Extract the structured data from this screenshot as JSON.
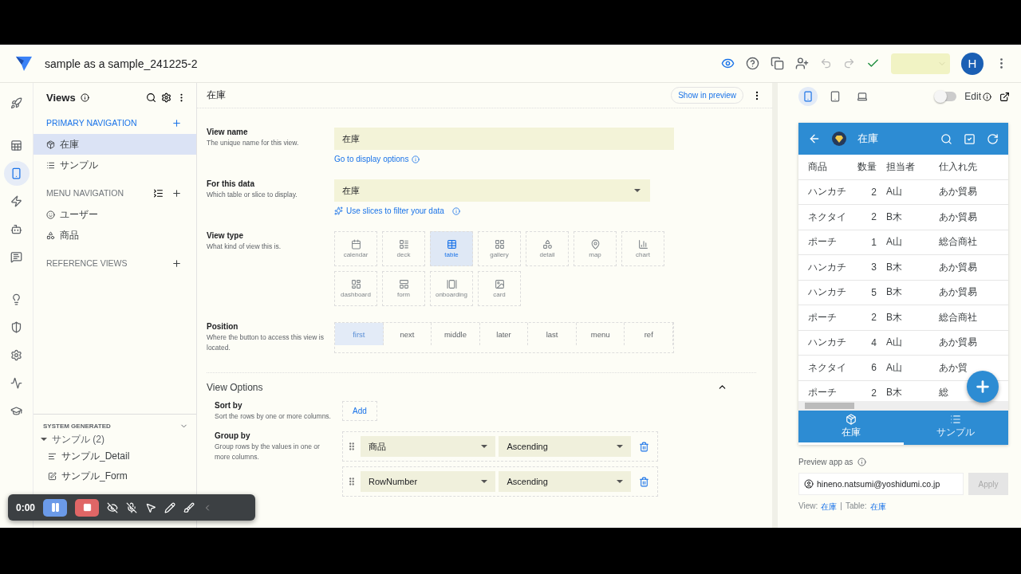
{
  "app": {
    "title": "sample as a sample_241225-2",
    "avatar": "H"
  },
  "rail": [
    {
      "items": [
        {
          "kind": "rocket",
          "selected": false
        }
      ]
    },
    {
      "items": [
        {
          "kind": "table",
          "selected": false
        },
        {
          "kind": "phone",
          "selected": true
        },
        {
          "kind": "bolt",
          "selected": false
        },
        {
          "kind": "bot",
          "selected": false
        },
        {
          "kind": "chat",
          "selected": false
        }
      ]
    },
    {
      "items": [
        {
          "kind": "bulb",
          "selected": false
        },
        {
          "kind": "shield",
          "selected": false
        },
        {
          "kind": "gear",
          "selected": false
        },
        {
          "kind": "monitor",
          "selected": false
        },
        {
          "kind": "school",
          "selected": false
        }
      ]
    }
  ],
  "views_panel": {
    "title": "Views",
    "sections": [
      {
        "heading": "PRIMARY NAVIGATION",
        "active": true,
        "items": [
          {
            "label": "在庫",
            "kind": "inventory",
            "selected": true
          },
          {
            "label": "サンプル",
            "kind": "list",
            "selected": false
          }
        ]
      },
      {
        "heading": "MENU NAVIGATION",
        "active": false,
        "items": [
          {
            "label": "ユーザー",
            "kind": "smile",
            "selected": false
          },
          {
            "label": "商品",
            "kind": "shapes",
            "selected": false
          }
        ]
      },
      {
        "heading": "REFERENCE VIEWS",
        "active": false
      }
    ],
    "system_generated": {
      "heading": "SYSTEM GENERATED",
      "group": {
        "label": "サンプル",
        "count": "(2)",
        "expanded": true,
        "children": [
          {
            "label": "サンプル_Detail",
            "kind": "detail"
          },
          {
            "label": "サンプル_Form",
            "kind": "form"
          }
        ]
      }
    }
  },
  "editor": {
    "title": "在庫",
    "preview_button": "Show in preview",
    "view_name": {
      "label": "View name",
      "hint": "The unique name for this view.",
      "value": "在庫",
      "link": "Go to display options"
    },
    "data": {
      "label": "For this data",
      "hint": "Which table or slice to display.",
      "value": "在庫",
      "link": "Use slices to filter your data"
    },
    "view_type": {
      "label": "View type",
      "hint": "What kind of view this is.",
      "options": [
        {
          "label": "calendar",
          "kind": "calendar",
          "selected": false
        },
        {
          "label": "deck",
          "kind": "deck",
          "selected": false
        },
        {
          "label": "table",
          "kind": "table",
          "selected": true
        },
        {
          "label": "gallery",
          "kind": "gallery",
          "selected": false
        },
        {
          "label": "detail",
          "kind": "detail",
          "selected": false
        },
        {
          "label": "map",
          "kind": "map",
          "selected": false
        },
        {
          "label": "chart",
          "kind": "chart",
          "selected": false
        },
        {
          "label": "dashboard",
          "kind": "dashboard",
          "selected": false
        },
        {
          "label": "form",
          "kind": "form",
          "selected": false
        },
        {
          "label": "onboarding",
          "kind": "onboarding",
          "selected": false
        },
        {
          "label": "card",
          "kind": "card",
          "selected": false
        }
      ]
    },
    "position": {
      "label": "Position",
      "hint": "Where the button to access this view is located.",
      "options": [
        {
          "label": "first",
          "selected": true
        },
        {
          "label": "next",
          "selected": false
        },
        {
          "label": "middle",
          "selected": false
        },
        {
          "label": "later",
          "selected": false
        },
        {
          "label": "last",
          "selected": false
        },
        {
          "label": "menu",
          "selected": false
        },
        {
          "label": "ref",
          "selected": false
        }
      ]
    },
    "view_options": {
      "title": "View Options",
      "expanded": true,
      "sort_by": {
        "label": "Sort by",
        "hint": "Sort the rows by one or more columns.",
        "button": "Add"
      },
      "group_by": {
        "label": "Group by",
        "hint": "Group rows by the values in one or more columns.",
        "rows": [
          {
            "column": "商品",
            "order": "Ascending"
          },
          {
            "column": "RowNumber",
            "order": "Ascending"
          }
        ]
      }
    }
  },
  "preview": {
    "devices": [
      {
        "kind": "phone",
        "selected": true
      },
      {
        "kind": "tablet",
        "selected": false
      },
      {
        "kind": "desktop",
        "selected": false
      }
    ],
    "edit_toggle": {
      "label": "Edit",
      "on": false
    },
    "app_bar_title": "在庫",
    "table": {
      "columns": [
        "商品",
        "数量",
        "担当者",
        "仕入れ先"
      ],
      "rows": [
        [
          "ハンカチ",
          "2",
          "A山",
          "あか貿易"
        ],
        [
          "ネクタイ",
          "2",
          "B木",
          "あか貿易"
        ],
        [
          "ポーチ",
          "1",
          "A山",
          "総合商社"
        ],
        [
          "ハンカチ",
          "3",
          "B木",
          "あか貿易"
        ],
        [
          "ハンカチ",
          "5",
          "B木",
          "あか貿易"
        ],
        [
          "ポーチ",
          "2",
          "B木",
          "総合商社"
        ],
        [
          "ハンカチ",
          "4",
          "A山",
          "あか貿易"
        ],
        [
          "ネクタイ",
          "6",
          "A山",
          "あか貿"
        ],
        [
          "ポーチ",
          "2",
          "B木",
          "総"
        ]
      ]
    },
    "bottom_nav": [
      {
        "label": "在庫",
        "kind": "inventory",
        "selected": true
      },
      {
        "label": "サンプル",
        "kind": "list",
        "selected": false
      }
    ],
    "preview_as": {
      "label": "Preview app as",
      "value": "hineno.natsumi@yoshidumi.co.jp",
      "button": "Apply",
      "disabled": true
    },
    "footer": {
      "view_label": "View:",
      "view_value": "在庫",
      "separator": "|",
      "table_label": "Table:",
      "table_value": "在庫"
    }
  },
  "recorder": {
    "time": "0:00"
  }
}
